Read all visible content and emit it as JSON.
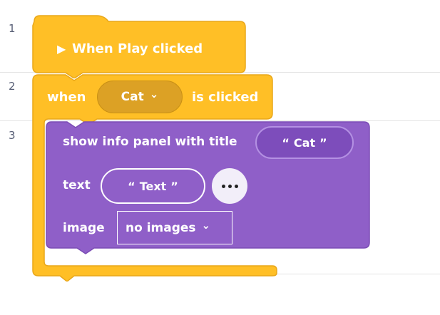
{
  "line_numbers": [
    "1",
    "2",
    "3"
  ],
  "event_block": {
    "play_icon": "▶",
    "label": "When Play clicked"
  },
  "when_block": {
    "prefix": "when",
    "sprite_value": "Cat",
    "suffix": "is clicked"
  },
  "info_panel_block": {
    "label": "show info panel with title",
    "title_value": "Cat",
    "text_label": "text",
    "text_value": "Text",
    "more_icon": "ellipsis-icon",
    "image_label": "image",
    "image_value": "no images"
  },
  "glyphs": {
    "quote_open": "“",
    "quote_close": "”",
    "chevron": "⌄"
  },
  "colors": {
    "event_yellow": "#ffbf26",
    "event_border": "#e9a719",
    "dropdown_yellow": "#dca125",
    "looks_purple": "#8f5fc8",
    "looks_border": "#7b4db5",
    "pill_dark_purple": "#7d4dbb"
  }
}
